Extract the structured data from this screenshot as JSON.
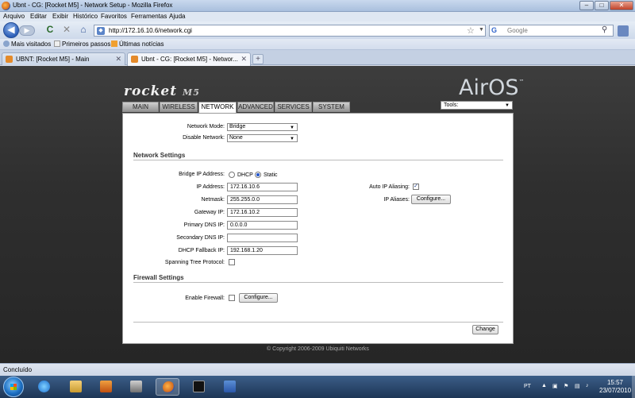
{
  "window": {
    "title": "Ubnt - CG: [Rocket M5] - Network Setup - Mozilla Firefox",
    "minimize": "–",
    "maximize": "□",
    "close": "✕"
  },
  "menu": [
    "Arquivo",
    "Editar",
    "Exibir",
    "Histórico",
    "Favoritos",
    "Ferramentas",
    "Ajuda"
  ],
  "nav": {
    "back": "◀",
    "forward": "▶",
    "reload": "C",
    "stop": "✕",
    "home": "⌂",
    "url": "http://172.16.10.6/network.cgi",
    "search_placeholder": "Google",
    "search_engine": "G"
  },
  "bookmarks": [
    "Mais visitados",
    "Primeiros passos",
    "Últimas notícias"
  ],
  "tabs": [
    {
      "label": "UBNT: [Rocket M5] - Main"
    },
    {
      "label": "Ubnt - CG: [Rocket M5] - Networ..."
    }
  ],
  "brand": {
    "product": "rocket",
    "model": "M5",
    "os": "AirOS",
    "tm": "™"
  },
  "navtabs": [
    "MAIN",
    "WIRELESS",
    "NETWORK",
    "ADVANCED",
    "SERVICES",
    "SYSTEM"
  ],
  "tools": {
    "value": "Tools:"
  },
  "form": {
    "network_mode_label": "Network Mode:",
    "network_mode_value": "Bridge",
    "disable_network_label": "Disable Network:",
    "disable_network_value": "None",
    "network_settings_title": "Network Settings",
    "bridge_ip_label": "Bridge IP Address:",
    "dhcp_label": "DHCP",
    "static_label": "Static",
    "ip_label": "IP Address:",
    "ip_value": "172.16.10.6",
    "netmask_label": "Netmask:",
    "netmask_value": "255.255.0.0",
    "gateway_label": "Gateway IP:",
    "gateway_value": "172.16.10.2",
    "primary_dns_label": "Primary DNS IP:",
    "primary_dns_value": "0.0.0.0",
    "secondary_dns_label": "Secondary DNS IP:",
    "secondary_dns_value": "",
    "dhcp_fallback_label": "DHCP Fallback IP:",
    "dhcp_fallback_value": "192.168.1.20",
    "stp_label": "Spanning Tree Protocol:",
    "auto_alias_label": "Auto IP Aliasing:",
    "ip_aliases_label": "IP Aliases:",
    "configure_label": "Configure...",
    "firewall_title": "Firewall Settings",
    "enable_firewall_label": "Enable Firewall:",
    "change_label": "Change"
  },
  "copyright": "© Copyright 2006-2009 Ubiquiti Networks",
  "status": "Concluído",
  "tray": {
    "lang": "PT",
    "time": "15:57",
    "date": "23/07/2010"
  }
}
